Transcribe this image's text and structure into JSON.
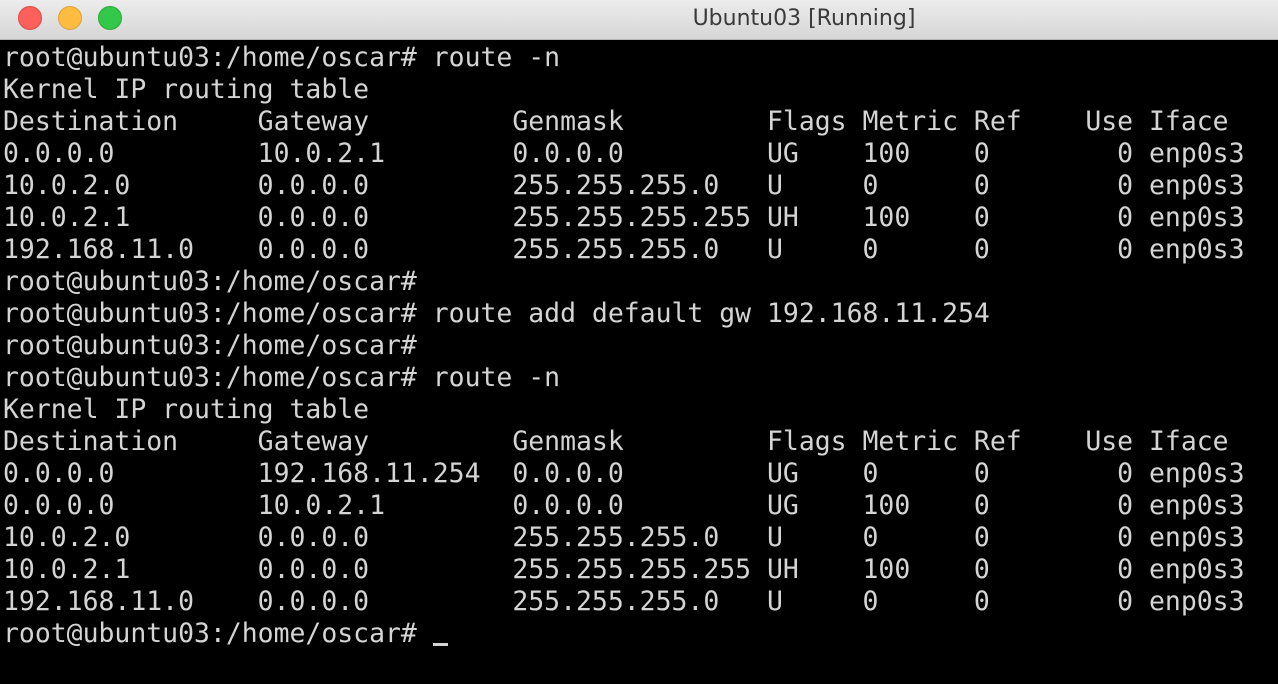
{
  "window": {
    "title": "Ubuntu03 [Running]"
  },
  "terminal": {
    "lines": [
      "root@ubuntu03:/home/oscar# route -n",
      "Kernel IP routing table",
      "Destination     Gateway         Genmask         Flags Metric Ref    Use Iface",
      "0.0.0.0         10.0.2.1        0.0.0.0         UG    100    0        0 enp0s3",
      "10.0.2.0        0.0.0.0         255.255.255.0   U     0      0        0 enp0s3",
      "10.0.2.1        0.0.0.0         255.255.255.255 UH    100    0        0 enp0s3",
      "192.168.11.0    0.0.0.0         255.255.255.0   U     0      0        0 enp0s3",
      "root@ubuntu03:/home/oscar#",
      "root@ubuntu03:/home/oscar# route add default gw 192.168.11.254",
      "root@ubuntu03:/home/oscar#",
      "root@ubuntu03:/home/oscar# route -n",
      "Kernel IP routing table",
      "Destination     Gateway         Genmask         Flags Metric Ref    Use Iface",
      "0.0.0.0         192.168.11.254  0.0.0.0         UG    0      0        0 enp0s3",
      "0.0.0.0         10.0.2.1        0.0.0.0         UG    100    0        0 enp0s3",
      "10.0.2.0        0.0.0.0         255.255.255.0   U     0      0        0 enp0s3",
      "10.0.2.1        0.0.0.0         255.255.255.255 UH    100    0        0 enp0s3",
      "192.168.11.0    0.0.0.0         255.255.255.0   U     0      0        0 enp0s3"
    ],
    "prompt": "root@ubuntu03:/home/oscar# "
  }
}
